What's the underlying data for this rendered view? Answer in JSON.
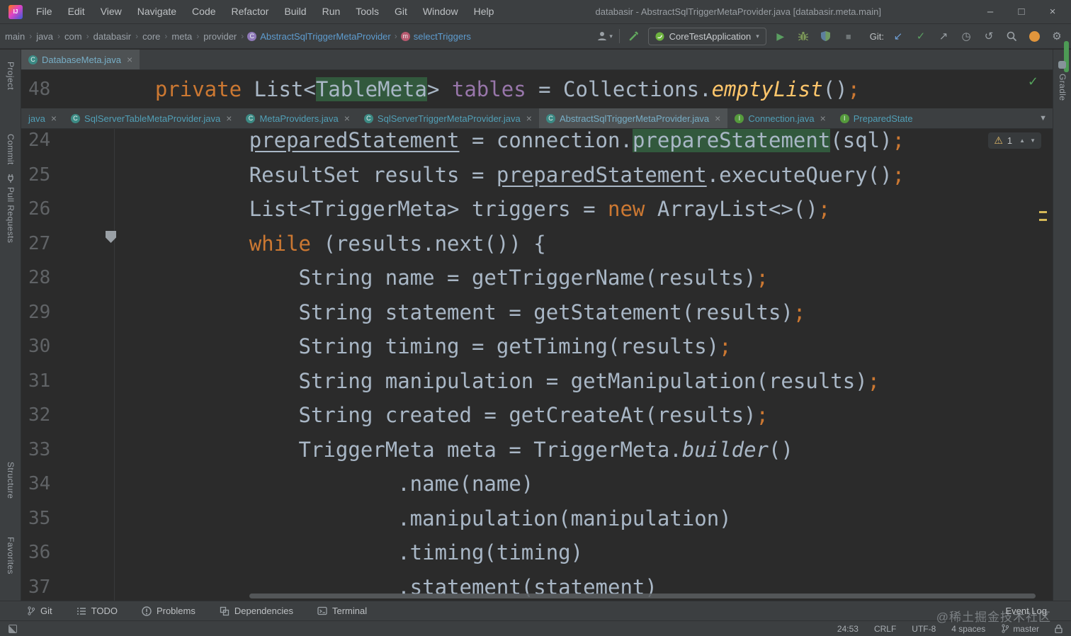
{
  "title_bar": {
    "menus": [
      "File",
      "Edit",
      "View",
      "Navigate",
      "Code",
      "Refactor",
      "Build",
      "Run",
      "Tools",
      "Git",
      "Window",
      "Help"
    ],
    "title": "databasir - AbstractSqlTriggerMetaProvider.java [databasir.meta.main]",
    "controls": {
      "minimize": "–",
      "maximize": "□",
      "close": "×"
    }
  },
  "toolbar": {
    "path": [
      "main",
      "java",
      "com",
      "databasir",
      "core",
      "meta",
      "provider"
    ],
    "class_crumb": "AbstractSqlTriggerMetaProvider",
    "method_crumb": "selectTriggers",
    "run_config": "CoreTestApplication",
    "git_label": "Git:"
  },
  "top_editor": {
    "tab_label": "DatabaseMeta.java",
    "close_glyph": "×",
    "line_number": "48",
    "indent": 4,
    "tokens": [
      {
        "s": "k",
        "t": "private"
      },
      {
        "s": "d",
        "t": " List<"
      },
      {
        "s": "hl",
        "t": "TableMeta"
      },
      {
        "s": "d",
        "t": "> "
      },
      {
        "s": "f",
        "t": "tables"
      },
      {
        "s": "d",
        "t": " = Collections."
      },
      {
        "s": "sm",
        "t": "emptyList"
      },
      {
        "s": "d",
        "t": "()"
      },
      {
        "s": "k",
        "t": ";"
      }
    ]
  },
  "tabs": [
    {
      "label": "java",
      "icon": "",
      "active": false,
      "close": "×"
    },
    {
      "label": "SqlServerTableMetaProvider.java",
      "icon": "class",
      "active": false,
      "close": "×"
    },
    {
      "label": "MetaProviders.java",
      "icon": "class",
      "active": false,
      "close": "×"
    },
    {
      "label": "SqlServerTriggerMetaProvider.java",
      "icon": "class",
      "active": false,
      "close": "×"
    },
    {
      "label": "AbstractSqlTriggerMetaProvider.java",
      "icon": "class",
      "active": true,
      "close": "×"
    },
    {
      "label": "Connection.java",
      "icon": "interface",
      "active": false,
      "close": "×"
    },
    {
      "label": "PreparedState",
      "icon": "interface",
      "active": false,
      "close": ""
    }
  ],
  "editor": {
    "warning_count": "1",
    "lines": [
      {
        "num": "24",
        "indent": 8,
        "tokens": [
          {
            "s": "u",
            "t": "preparedStatement"
          },
          {
            "s": "d",
            "t": " = connection."
          },
          {
            "s": "hl",
            "t": "prepareStatement"
          },
          {
            "s": "d",
            "t": "(sql)"
          },
          {
            "s": "k",
            "t": ";"
          }
        ]
      },
      {
        "num": "25",
        "indent": 8,
        "tokens": [
          {
            "s": "d",
            "t": "ResultSet results = "
          },
          {
            "s": "u",
            "t": "preparedStatement"
          },
          {
            "s": "d",
            "t": ".executeQuery()"
          },
          {
            "s": "k",
            "t": ";"
          }
        ]
      },
      {
        "num": "26",
        "indent": 8,
        "tokens": [
          {
            "s": "d",
            "t": "List<TriggerMeta> triggers = "
          },
          {
            "s": "k",
            "t": "new"
          },
          {
            "s": "d",
            "t": " ArrayList<>()"
          },
          {
            "s": "k",
            "t": ";"
          }
        ]
      },
      {
        "num": "27",
        "indent": 8,
        "tokens": [
          {
            "s": "k",
            "t": "while"
          },
          {
            "s": "d",
            "t": " (results.next()) {"
          }
        ]
      },
      {
        "num": "28",
        "indent": 12,
        "tokens": [
          {
            "s": "d",
            "t": "String name = getTriggerName(results)"
          },
          {
            "s": "k",
            "t": ";"
          }
        ]
      },
      {
        "num": "29",
        "indent": 12,
        "tokens": [
          {
            "s": "d",
            "t": "String statement = getStatement(results)"
          },
          {
            "s": "k",
            "t": ";"
          }
        ]
      },
      {
        "num": "30",
        "indent": 12,
        "tokens": [
          {
            "s": "d",
            "t": "String timing = getTiming(results)"
          },
          {
            "s": "k",
            "t": ";"
          }
        ]
      },
      {
        "num": "31",
        "indent": 12,
        "tokens": [
          {
            "s": "d",
            "t": "String manipulation = getManipulation(results)"
          },
          {
            "s": "k",
            "t": ";"
          }
        ]
      },
      {
        "num": "32",
        "indent": 12,
        "tokens": [
          {
            "s": "d",
            "t": "String created = getCreateAt(results)"
          },
          {
            "s": "k",
            "t": ";"
          }
        ]
      },
      {
        "num": "33",
        "indent": 12,
        "tokens": [
          {
            "s": "d",
            "t": "TriggerMeta meta = TriggerMeta."
          },
          {
            "s": "it",
            "t": "builder"
          },
          {
            "s": "d",
            "t": "()"
          }
        ]
      },
      {
        "num": "34",
        "indent": 20,
        "tokens": [
          {
            "s": "d",
            "t": ".name(name)"
          }
        ]
      },
      {
        "num": "35",
        "indent": 20,
        "tokens": [
          {
            "s": "d",
            "t": ".manipulation(manipulation)"
          }
        ]
      },
      {
        "num": "36",
        "indent": 20,
        "tokens": [
          {
            "s": "d",
            "t": ".timing(timing)"
          }
        ]
      },
      {
        "num": "37",
        "indent": 20,
        "tokens": [
          {
            "s": "d",
            "t": ".statement(statement)"
          }
        ]
      }
    ]
  },
  "left_stripe": [
    "Project",
    "Commit",
    "Pull Requests",
    "Structure",
    "Favorites"
  ],
  "right_stripe": [
    "Gradle"
  ],
  "bottom_bar": {
    "items": [
      "Git",
      "TODO",
      "Problems",
      "Dependencies",
      "Terminal"
    ],
    "event_log": "Event Log"
  },
  "status_bar": {
    "caret": "24:53",
    "line_ending": "CRLF",
    "encoding": "UTF-8",
    "indent": "4 spaces",
    "branch": "master"
  },
  "watermark": "@稀土掘金技术社区",
  "colors": {
    "keyword": "#cc7832",
    "field": "#9876aa",
    "static_method": "#ffc66b",
    "highlight_bg": "#32593d",
    "default_text": "#a9b7c6",
    "tab_text": "#519fb6",
    "tab_active_text": "#77aec6",
    "run_green": "#5a9e61",
    "warning": "#e8bf6a",
    "crumb_link": "#5e9ccf"
  }
}
